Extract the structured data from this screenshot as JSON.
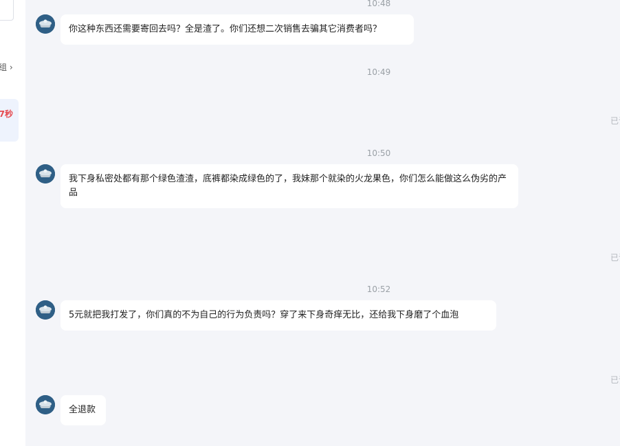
{
  "sidebar": {
    "group_label": "组 ›",
    "timer_text": "7秒"
  },
  "chat": {
    "times": [
      "10:48",
      "10:49",
      "10:50",
      "10:52"
    ],
    "messages": [
      {
        "text": "你这种东西还需要寄回去吗？全是渣了。你们还想二次销售去骗其它消费者吗？"
      },
      {
        "text": "我下身私密处都有那个绿色渣渣，底裤都染成绿色的了，我妹那个就染的火龙果色，你们怎么能做这么伪劣的产品"
      },
      {
        "text": "5元就把我打发了，你们真的不为自己的行为负责吗？穿了来下身奇痒无比，还给我下身磨了个血泡"
      },
      {
        "text": "全退款"
      }
    ],
    "read_label": "已读"
  },
  "icons": {
    "avatar": "user-avatar-icon"
  },
  "colors": {
    "chat_background": "#f4f5f9",
    "bubble": "#ffffff",
    "timer_red": "#e5484d",
    "avatar_blue": "#2f5f86"
  }
}
